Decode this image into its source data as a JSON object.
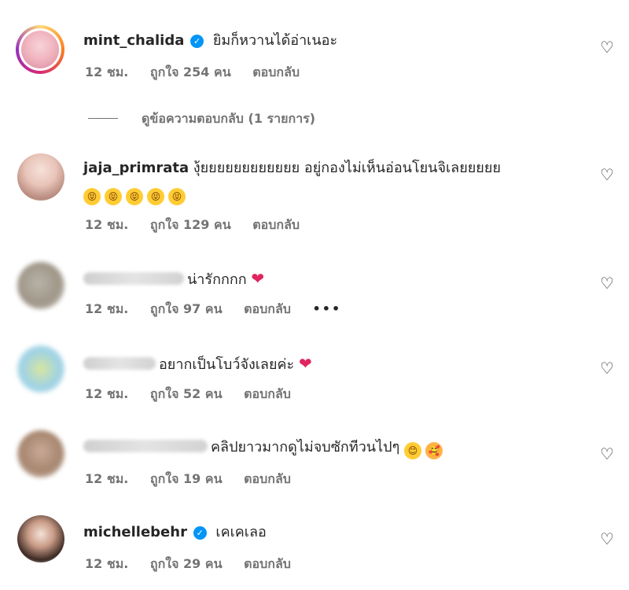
{
  "comments": [
    {
      "username": "mint_chalida",
      "verified": true,
      "text": "ยิมก็หวานได้อ่าเนอะ",
      "time": "12 ชม.",
      "likes": "ถูกใจ 254 คน",
      "reply": "ตอบกลับ",
      "view_replies": "ดูข้อความตอบกลับ (1 รายการ)"
    },
    {
      "username": "jaja_primrata",
      "verified": false,
      "text": "งุ้ยยยยยยยยยยยย อยู่กองไม่เห็นอ่อนโยนจิเลยยยยย",
      "emoji_line": [
        "😝",
        "😝",
        "😝",
        "😝",
        "😝"
      ],
      "time": "12 ชม.",
      "likes": "ถูกใจ 129 คน",
      "reply": "ตอบกลับ"
    },
    {
      "username_blurred": true,
      "text": "น่ารักกกก",
      "time": "12 ชม.",
      "likes": "ถูกใจ 97 คน",
      "reply": "ตอบกลับ",
      "more": "•••"
    },
    {
      "username_blurred": true,
      "text": "อยากเป็นโบว์จังเลยค่ะ",
      "time": "12 ชม.",
      "likes": "ถูกใจ 52 คน",
      "reply": "ตอบกลับ"
    },
    {
      "username_blurred": true,
      "text": "คลิปยาวมากดูไม่จบซักทีวนไปๆ",
      "time": "12 ชม.",
      "likes": "ถูกใจ 19 คน",
      "reply": "ตอบกลับ"
    },
    {
      "username": "michellebehr",
      "verified": true,
      "text": "เคเคเลอ",
      "time": "12 ชม.",
      "likes": "ถูกใจ 29 คน",
      "reply": "ตอบกลับ"
    }
  ],
  "icons": {
    "like": "heart-outline-icon",
    "verified": "verified-badge-icon",
    "emoji": "emoji-icon"
  },
  "colors": {
    "verified": "#0095f6",
    "meta": "#737373",
    "heart_red": "#e0245e"
  }
}
